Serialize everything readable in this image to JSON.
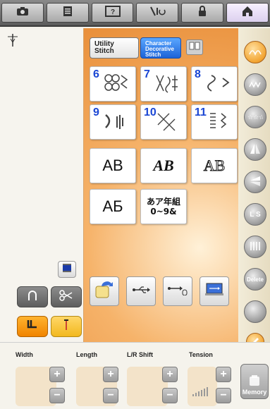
{
  "toolbar": {
    "buttons": [
      {
        "icon": "camera-icon"
      },
      {
        "icon": "document-icon"
      },
      {
        "icon": "help-icon"
      },
      {
        "icon": "needle-thread-icon"
      },
      {
        "icon": "lock-icon"
      },
      {
        "icon": "home-icon"
      }
    ]
  },
  "tabs": {
    "utility": "Utility Stitch",
    "character": "Character Decorative Stitch"
  },
  "stitch_tiles": [
    {
      "number": "6"
    },
    {
      "number": "7"
    },
    {
      "number": "8"
    },
    {
      "number": "9"
    },
    {
      "number": "10"
    },
    {
      "number": "11"
    }
  ],
  "font_tiles": [
    {
      "text": "AB",
      "style": "sans"
    },
    {
      "text": "AB",
      "style": "script"
    },
    {
      "text": "AB",
      "style": "outline"
    },
    {
      "text": "АБ",
      "style": "cyrillic"
    },
    {
      "text": "あア年組\n0~9&",
      "style": "japanese"
    }
  ],
  "right_buttons": [
    {
      "label": "",
      "icon": "stitch-orange-icon"
    },
    {
      "label": "",
      "icon": "stitch-grey-icon"
    },
    {
      "label": "",
      "icon": "stars-icon"
    },
    {
      "label": "",
      "icon": "mirror-icon"
    },
    {
      "label": "",
      "icon": "mirror-vertical-icon"
    },
    {
      "label": "L S",
      "icon": "length-size-icon"
    },
    {
      "label": "",
      "icon": "density-icon"
    },
    {
      "label": "Delete",
      "icon": "delete-icon"
    },
    {
      "label": "",
      "icon": "blank-icon"
    },
    {
      "label": "",
      "icon": "pencil-icon"
    }
  ],
  "bottom": {
    "params": [
      {
        "label": "Width"
      },
      {
        "label": "Length"
      },
      {
        "label": "L/R Shift"
      },
      {
        "label": "Tension"
      }
    ],
    "memory_label": "Memory"
  },
  "colors": {
    "accent_orange": "#f2a431",
    "tab_blue": "#1d63d8",
    "digit_blue": "#1a46d4"
  }
}
